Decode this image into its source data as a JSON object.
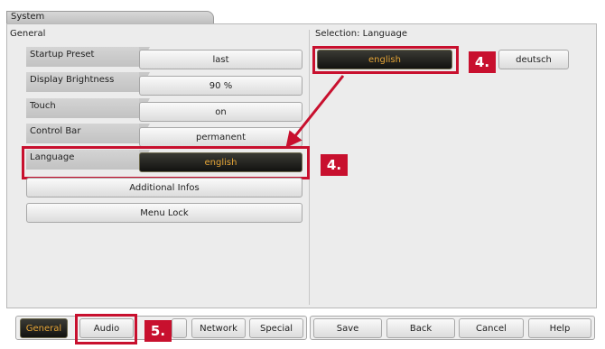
{
  "window": {
    "title": "System"
  },
  "left_panel": {
    "title": "General",
    "rows": [
      {
        "label": "Startup Preset",
        "value": "last"
      },
      {
        "label": "Display Brightness",
        "value": "90 %"
      },
      {
        "label": "Touch",
        "value": "on"
      },
      {
        "label": "Control Bar",
        "value": "permanent"
      },
      {
        "label": "Language",
        "value": "english"
      }
    ],
    "additional_infos": "Additional Infos",
    "menu_lock": "Menu Lock"
  },
  "right_panel": {
    "title": "Selection: Language",
    "options": [
      "english",
      "deutsch"
    ]
  },
  "annotations": {
    "step4": "4.",
    "step5": "5."
  },
  "bottom_tabs": [
    "General",
    "Audio",
    "",
    "Network",
    "Special"
  ],
  "bottom_actions": [
    "Save",
    "Back",
    "Cancel",
    "Help"
  ],
  "colors": {
    "highlight": "#c8102e",
    "selected_text": "#e4a437"
  }
}
